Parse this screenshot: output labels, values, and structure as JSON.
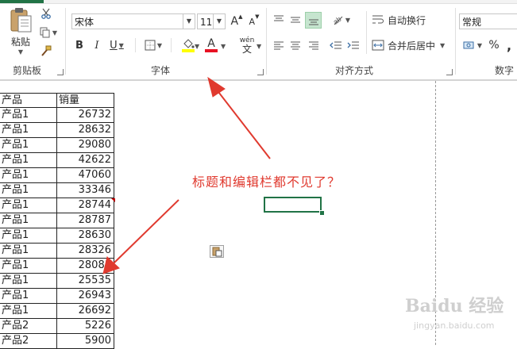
{
  "ribbon": {
    "clipboard": {
      "paste_label": "粘贴",
      "group_label": "剪贴板"
    },
    "font": {
      "font_name": "宋体",
      "font_size": "11",
      "grow_label": "A",
      "shrink_label": "A",
      "bold_label": "B",
      "italic_label": "I",
      "underline_label": "U",
      "font_color_label": "A",
      "phonetic_label": "wén",
      "group_label": "字体"
    },
    "alignment": {
      "wrap_text_label": "自动换行",
      "merge_center_label": "合并后居中",
      "group_label": "对齐方式"
    },
    "number": {
      "format_value": "常规",
      "percent_label": "%",
      "group_label": "数字"
    },
    "colors": {
      "accent": "#217346",
      "highlight_yellow": "#ffff00",
      "font_red": "#e81123"
    }
  },
  "sheet": {
    "headers": [
      "产品",
      "销量"
    ],
    "rows": [
      [
        "产品1",
        "26732"
      ],
      [
        "产品1",
        "28632"
      ],
      [
        "产品1",
        "29080"
      ],
      [
        "产品1",
        "42622"
      ],
      [
        "产品1",
        "47060"
      ],
      [
        "产品1",
        "33346"
      ],
      [
        "产品1",
        "28744"
      ],
      [
        "产品1",
        "28787"
      ],
      [
        "产品1",
        "28630"
      ],
      [
        "产品1",
        "28326"
      ],
      [
        "产品1",
        "28081"
      ],
      [
        "产品1",
        "25535"
      ],
      [
        "产品1",
        "26943"
      ],
      [
        "产品1",
        "26692"
      ],
      [
        "产品2",
        "5226"
      ],
      [
        "产品2",
        "5900"
      ]
    ]
  },
  "annotation": {
    "text": "标题和编辑栏都不见了？",
    "color": "#e03a2f"
  },
  "watermark": {
    "brand": "Baidu 经验",
    "url": "jingyan.baidu.com"
  }
}
